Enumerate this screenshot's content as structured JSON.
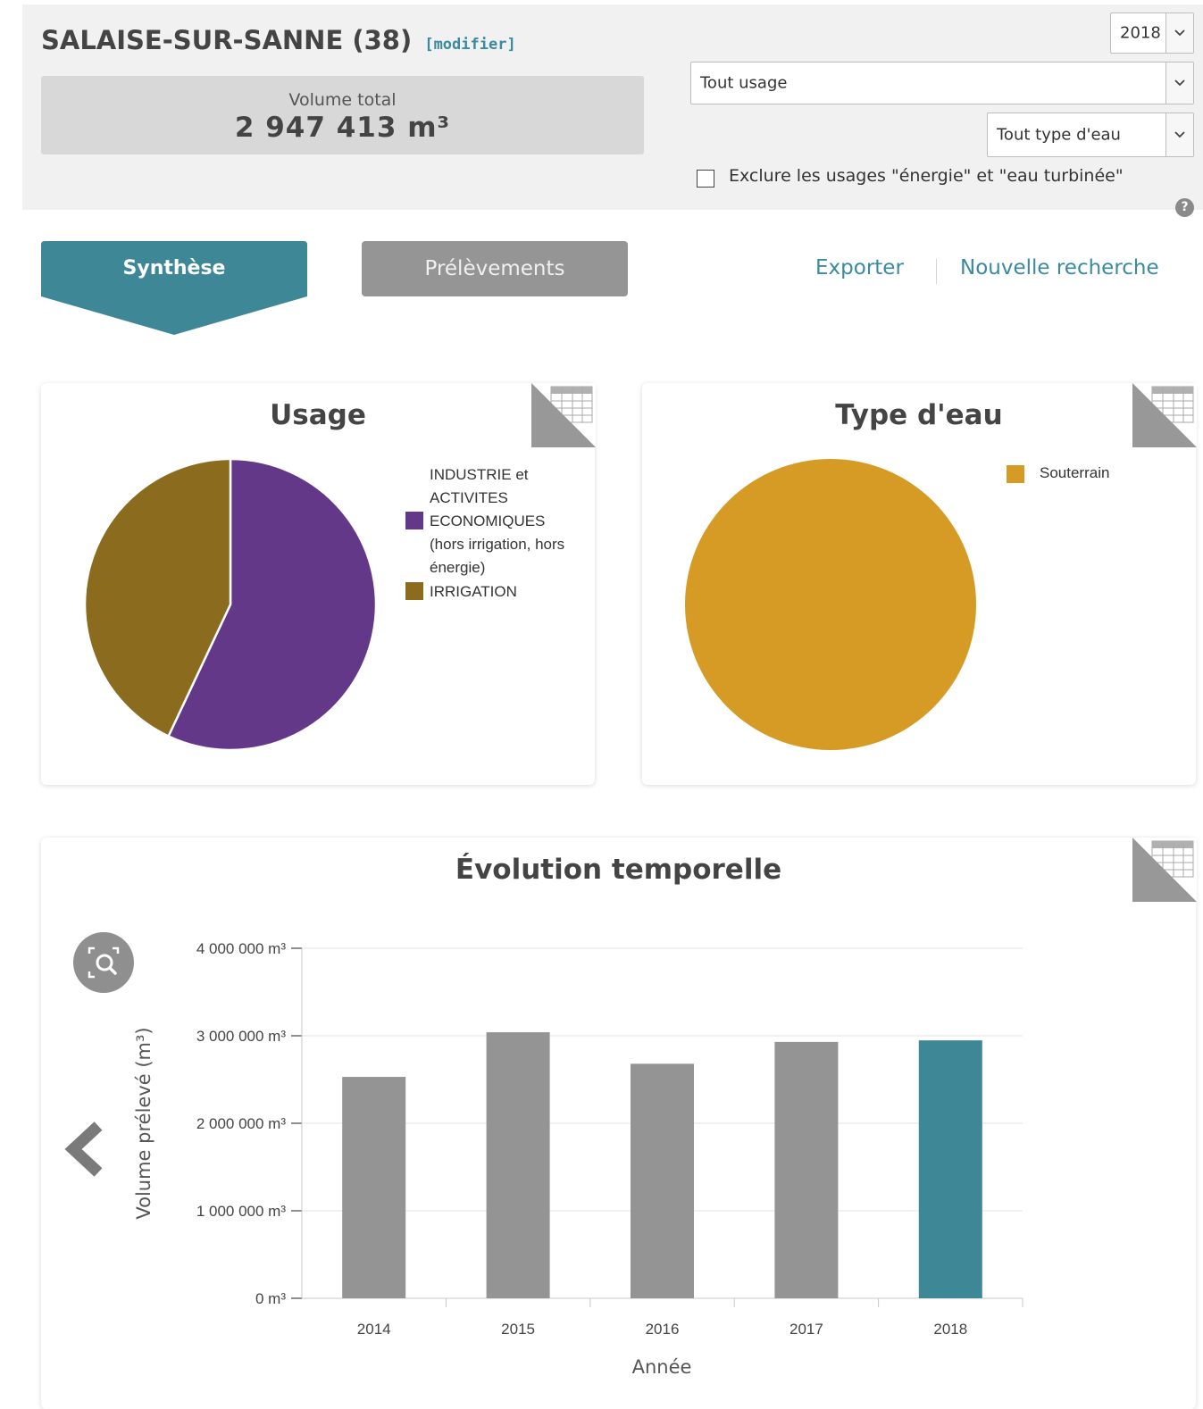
{
  "header": {
    "commune": "SALAISE-SUR-SANNE (38)",
    "modify_link": "[modifier]",
    "volume_label": "Volume total",
    "volume_value": "2 947 413 m³"
  },
  "filters": {
    "year": "2018",
    "usage": "Tout usage",
    "water_type": "Tout type d'eau",
    "exclude_label": "Exclure les usages \"énergie\" et \"eau turbinée\"",
    "exclude_checked": false,
    "help": "?"
  },
  "tabs": [
    {
      "label": "Synthèse",
      "active": true
    },
    {
      "label": "Prélèvements",
      "active": false
    }
  ],
  "links": {
    "export": "Exporter",
    "new_search": "Nouvelle recherche"
  },
  "icons": {
    "table": "table-icon",
    "zoom": "zoom-reset-icon",
    "back": "chevron-left-icon",
    "select": "chevron-down-icon",
    "help": "help-icon"
  },
  "colors": {
    "accent": "#3d8797",
    "industrie": "#643889",
    "irrigation": "#8b6b1d",
    "souterrain": "#d69b25",
    "bar_default": "#949494",
    "bar_selected": "#3d8797"
  },
  "chart_data": [
    {
      "type": "pie",
      "title": "Usage",
      "slices": [
        {
          "label": "INDUSTRIE et ACTIVITES ECONOMIQUES (hors irrigation, hors énergie)",
          "value": 57,
          "color": "#643889"
        },
        {
          "label": "IRRIGATION",
          "value": 43,
          "color": "#8b6b1d"
        }
      ],
      "legend": "right"
    },
    {
      "type": "pie",
      "title": "Type d'eau",
      "slices": [
        {
          "label": "Souterrain",
          "value": 100,
          "color": "#d69b25"
        }
      ],
      "legend": "right"
    },
    {
      "type": "bar",
      "title": "Évolution temporelle",
      "categories": [
        "2014",
        "2015",
        "2016",
        "2017",
        "2018"
      ],
      "values": [
        2530000,
        3040000,
        2680000,
        2930000,
        2947413
      ],
      "highlight": "2018",
      "xlabel": "Année",
      "ylabel": "Volume prélevé (m³)",
      "ylim": [
        0,
        4000000
      ],
      "yticks": [
        "0 m³",
        "1 000 000 m³",
        "2 000 000 m³",
        "3 000 000 m³",
        "4 000 000 m³"
      ],
      "grid": true
    }
  ]
}
